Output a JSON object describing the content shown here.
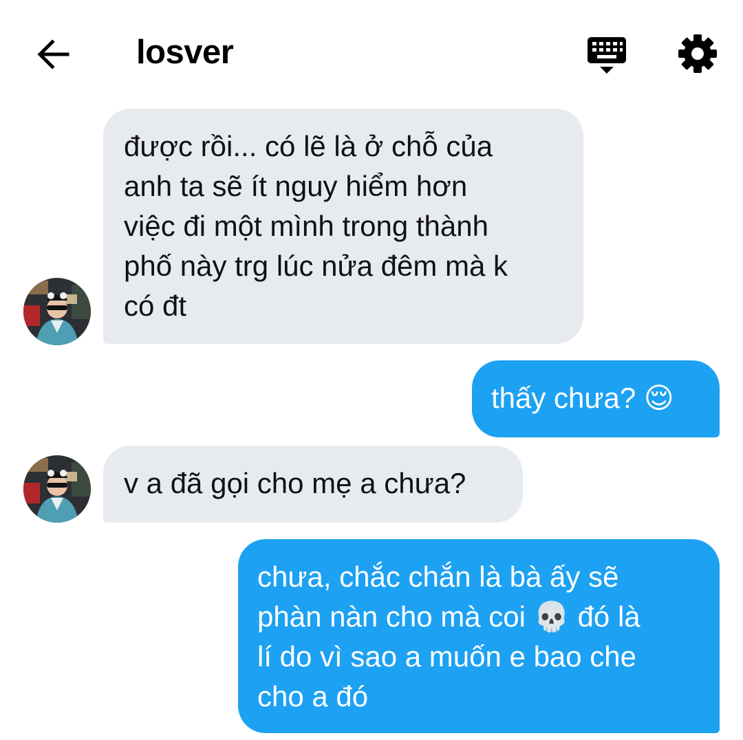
{
  "header": {
    "title": "losver",
    "back_icon": "arrow-left-icon",
    "keyboard_icon": "keyboard-icon",
    "settings_icon": "gear-icon"
  },
  "messages": [
    {
      "direction": "incoming",
      "text": "được rồi... có lẽ là ở chỗ của\nanh ta sẽ ít nguy hiểm hơn\nviệc đi một mình trong thành\nphố này trg lúc nửa đêm mà k\ncó đt"
    },
    {
      "direction": "outgoing",
      "text": "thấy chưa? 😌"
    },
    {
      "direction": "incoming",
      "text": "v a đã gọi cho mẹ a chưa?"
    },
    {
      "direction": "outgoing",
      "text": "chưa, chắc chắn là bà ấy sẽ\nphàn nàn cho mà coi 💀 đó là\nlí do vì sao a muốn e bao che\ncho a đó"
    }
  ],
  "colors": {
    "incoming_bubble": "#e7ebef",
    "outgoing_bubble": "#1da1f2",
    "outgoing_text": "#ffffff",
    "incoming_text": "#111111"
  }
}
